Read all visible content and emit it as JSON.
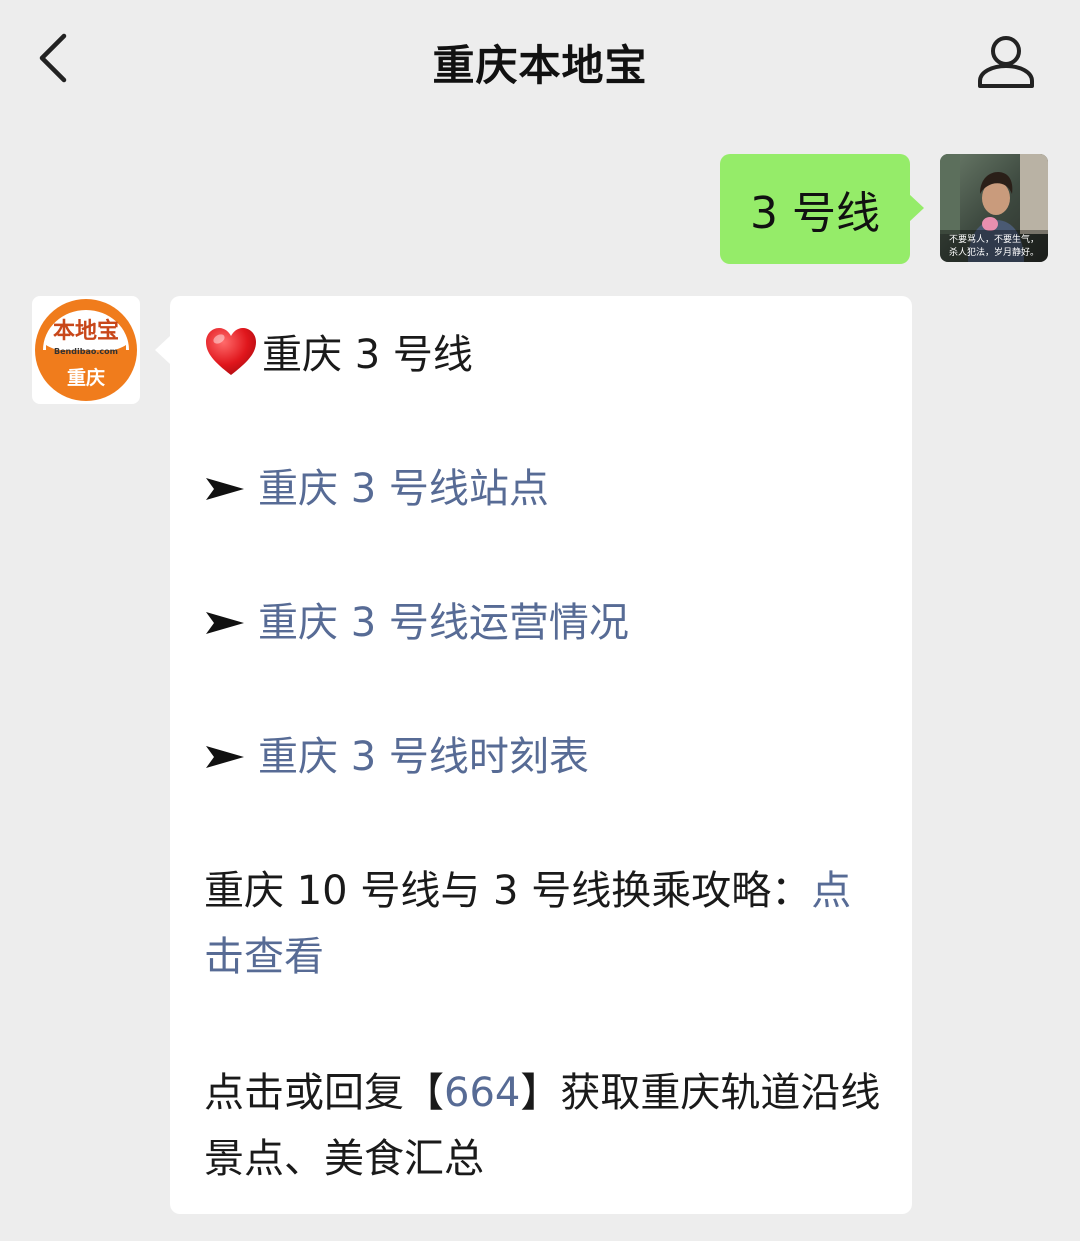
{
  "header": {
    "title": "重庆本地宝"
  },
  "sent_message": {
    "text": "3 号线"
  },
  "user_avatar": {
    "caption_line1": "不要骂人，不要生气，",
    "caption_line2": "杀人犯法，岁月静好。"
  },
  "bot_avatar": {
    "logo_text": "本地宝",
    "site_text": "Bendibao.com",
    "city_text": "重庆"
  },
  "reply": {
    "heading": "重庆 3 号线",
    "links": [
      {
        "label": "重庆 3 号线站点"
      },
      {
        "label": "重庆 3 号线运营情况"
      },
      {
        "label": "重庆 3 号线时刻表"
      }
    ],
    "transfer_text": "重庆 10 号线与 3 号线换乘攻略：",
    "transfer_link": "点击查看",
    "footer_prefix": "点击或回复【",
    "footer_code": "664",
    "footer_suffix": "】获取重庆轨道沿线景点、美食汇总"
  },
  "colors": {
    "background": "#ededed",
    "sent_bubble": "#95ec69",
    "link": "#576b95",
    "logo_orange": "#f07c1c"
  }
}
